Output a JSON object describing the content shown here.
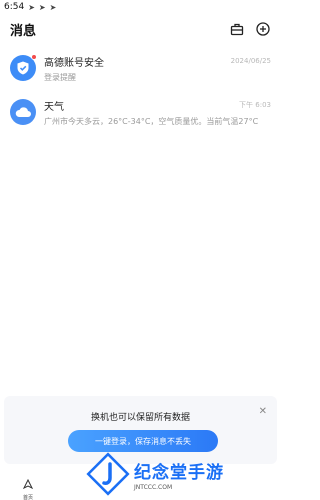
{
  "status_bar": {
    "time": "6:54"
  },
  "header": {
    "title": "消息"
  },
  "messages": [
    {
      "name": "高德账号安全",
      "time": "2024/06/25",
      "preview": "登录提醒"
    },
    {
      "name": "天气",
      "time": "下午 6:03",
      "preview": "广州市今天多云，26°C-34°C，空气质量优。当前气温27°C"
    }
  ],
  "login_panel": {
    "headline": "换机也可以保留所有数据",
    "button_label": "一键登录，保存消息不丢失"
  },
  "tabbar": {
    "items": [
      {
        "label": "首页"
      }
    ]
  },
  "watermark": {
    "title": "纪念堂手游",
    "subtitle": "JNTCCC.COM"
  },
  "colors": {
    "accent": "#2b79f6",
    "badge": "#f24b4b"
  }
}
